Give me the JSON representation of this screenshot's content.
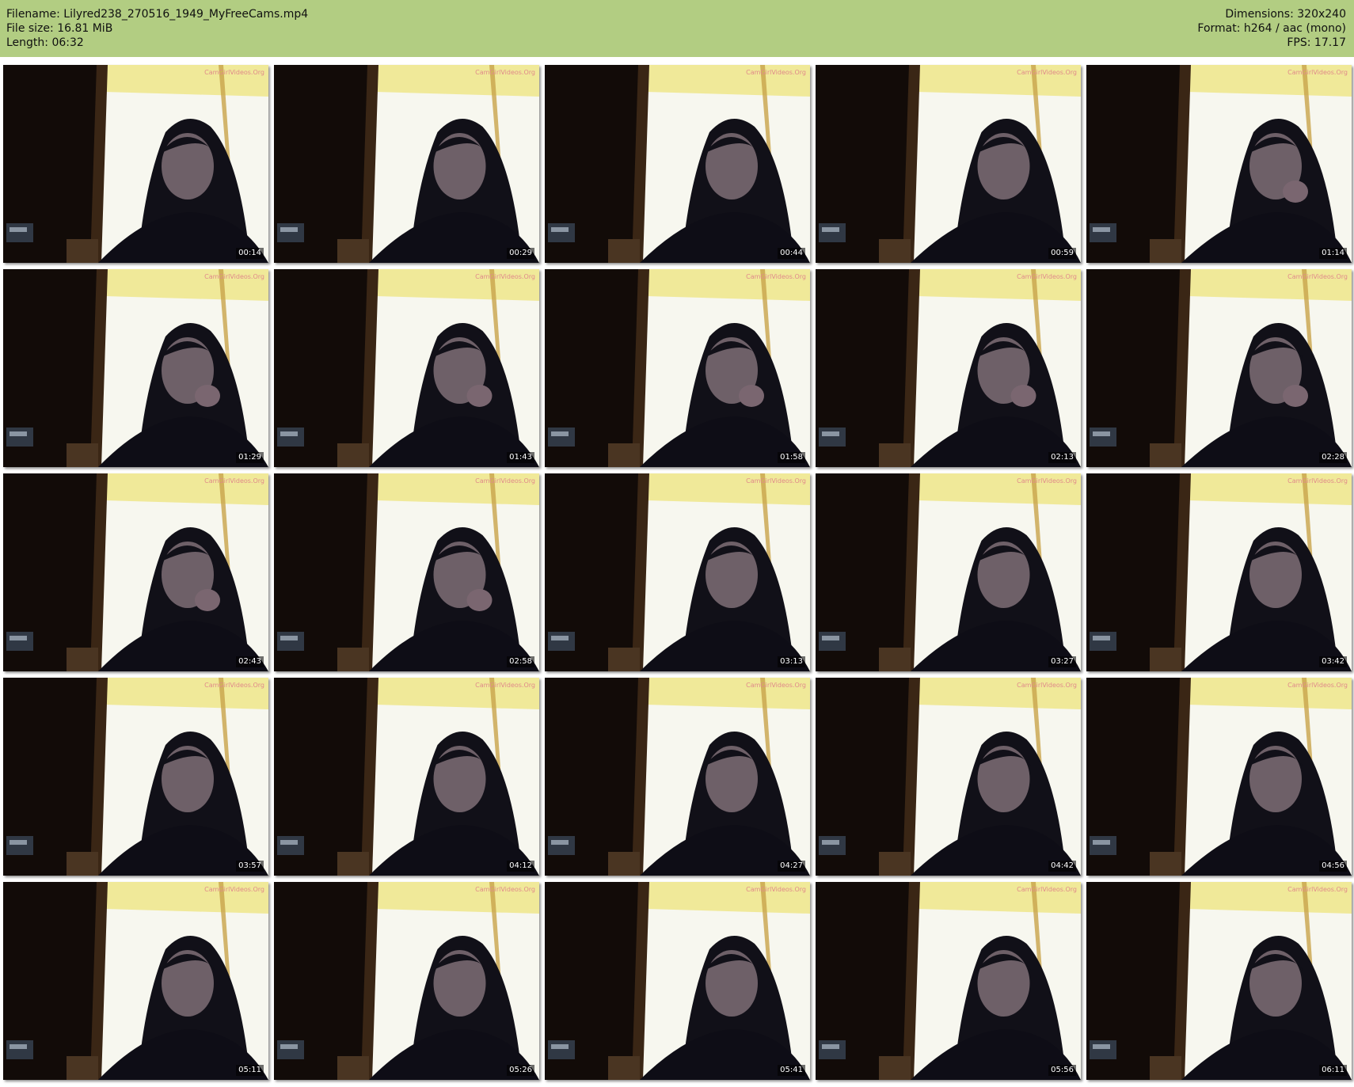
{
  "header": {
    "filename": "Filename: Lilyred238_270516_1949_MyFreeCams.mp4",
    "file_size": "File size: 16.81 MiB",
    "length": "Length: 06:32",
    "dimensions": "Dimensions: 320x240",
    "format": "Format: h264 / aac (mono)",
    "fps": "FPS: 17.17"
  },
  "thumbnails": [
    {
      "time": "00:14"
    },
    {
      "time": "00:29"
    },
    {
      "time": "00:44"
    },
    {
      "time": "00:59"
    },
    {
      "time": "01:14"
    },
    {
      "time": "01:29"
    },
    {
      "time": "01:43"
    },
    {
      "time": "01:58"
    },
    {
      "time": "02:13"
    },
    {
      "time": "02:28"
    },
    {
      "time": "02:43"
    },
    {
      "time": "02:58"
    },
    {
      "time": "03:13"
    },
    {
      "time": "03:27"
    },
    {
      "time": "03:42"
    },
    {
      "time": "03:57"
    },
    {
      "time": "04:12"
    },
    {
      "time": "04:27"
    },
    {
      "time": "04:42"
    },
    {
      "time": "04:56"
    },
    {
      "time": "05:11"
    },
    {
      "time": "05:26"
    },
    {
      "time": "05:41"
    },
    {
      "time": "05:56"
    },
    {
      "time": "06:11"
    }
  ],
  "colors": {
    "header_bg": "#b2cd82",
    "window_light": "#f7f7ef",
    "curtain_dark": "#0b0706",
    "hair_dark": "#111018",
    "skin": "#6e6068"
  }
}
